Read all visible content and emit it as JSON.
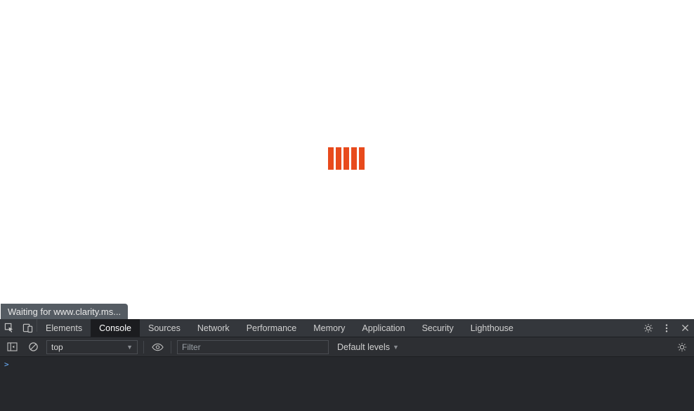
{
  "page": {
    "spinner_color": "#e84a1c"
  },
  "statusbar": {
    "text": "Waiting for www.clarity.ms..."
  },
  "devtools": {
    "tabs": {
      "elements": "Elements",
      "console": "Console",
      "sources": "Sources",
      "network": "Network",
      "performance": "Performance",
      "memory": "Memory",
      "application": "Application",
      "security": "Security",
      "lighthouse": "Lighthouse"
    },
    "toolbar": {
      "context": "top",
      "filter_placeholder": "Filter",
      "levels_label": "Default levels"
    },
    "prompt": ">"
  }
}
